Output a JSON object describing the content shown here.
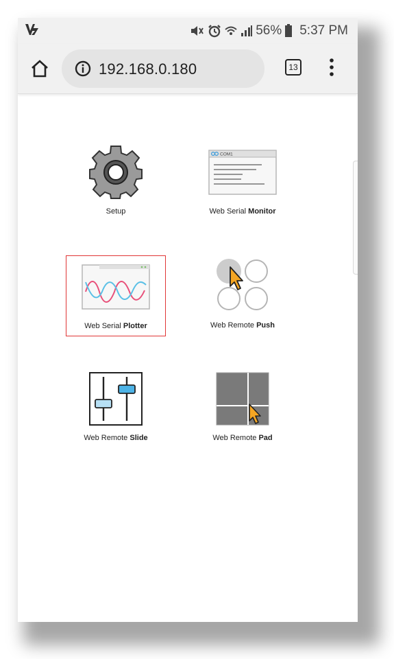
{
  "status_bar": {
    "battery_percent": "56%",
    "time": "5:37 PM",
    "icons": [
      "app-logo-icon",
      "mute-icon",
      "alarm-icon",
      "wifi-icon",
      "signal-icon",
      "battery-icon"
    ]
  },
  "toolbar": {
    "url": "192.168.0.180",
    "tab_count": "13",
    "icons": [
      "home-icon",
      "info-icon",
      "more-vert-icon"
    ]
  },
  "tiles": [
    {
      "id": "setup",
      "name": "Setup",
      "bold": "",
      "icon": "gear-icon"
    },
    {
      "id": "monitor",
      "name": "Web Serial ",
      "bold": "Monitor",
      "icon": "serial-monitor-icon",
      "window_title": "COM1"
    },
    {
      "id": "plotter",
      "name": "Web Serial ",
      "bold": "Plotter",
      "icon": "plotter-icon",
      "selected": true
    },
    {
      "id": "push",
      "name": "Web Remote ",
      "bold": "Push",
      "icon": "push-buttons-icon"
    },
    {
      "id": "slide",
      "name": "Web Remote ",
      "bold": "Slide",
      "icon": "sliders-icon"
    },
    {
      "id": "pad",
      "name": "Web Remote ",
      "bold": "Pad",
      "icon": "touch-pad-icon"
    }
  ],
  "colors": {
    "selection_border": "#e03535",
    "plot_wave_pink": "#e8507a",
    "plot_wave_blue": "#5bc0e6",
    "cursor_orange": "#f5a623",
    "slider_knob_blue": "#4db3e6",
    "slider_knob_light": "#b7e0f5",
    "pad_gray": "#7a7a7a",
    "gear_gray": "#9a9a9a"
  }
}
